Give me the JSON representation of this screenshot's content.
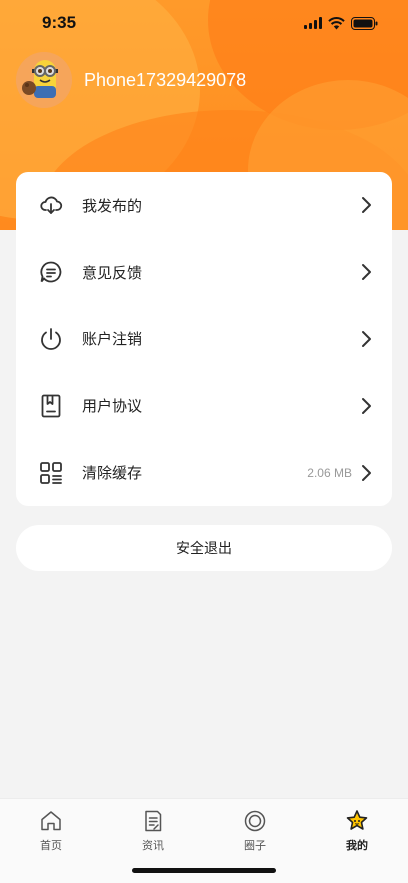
{
  "status_bar": {
    "time": "9:35"
  },
  "profile": {
    "username": "Phone17329429078"
  },
  "menu": {
    "items": [
      {
        "label": "我发布的",
        "icon": "cloud-download-icon",
        "extra": ""
      },
      {
        "label": "意见反馈",
        "icon": "chat-bubble-icon",
        "extra": ""
      },
      {
        "label": "账户注销",
        "icon": "power-icon",
        "extra": ""
      },
      {
        "label": "用户协议",
        "icon": "bookmark-document-icon",
        "extra": ""
      },
      {
        "label": "清除缓存",
        "icon": "grid-list-icon",
        "extra": "2.06 MB"
      }
    ]
  },
  "logout": {
    "label": "安全退出"
  },
  "tabs": [
    {
      "label": "首页",
      "icon": "home-icon",
      "active": false
    },
    {
      "label": "资讯",
      "icon": "news-document-icon",
      "active": false
    },
    {
      "label": "圈子",
      "icon": "circle-icon",
      "active": false
    },
    {
      "label": "我的",
      "icon": "star-face-icon",
      "active": true
    }
  ],
  "colors": {
    "accent": "#ff8a1e",
    "background": "#f3f3f3"
  }
}
